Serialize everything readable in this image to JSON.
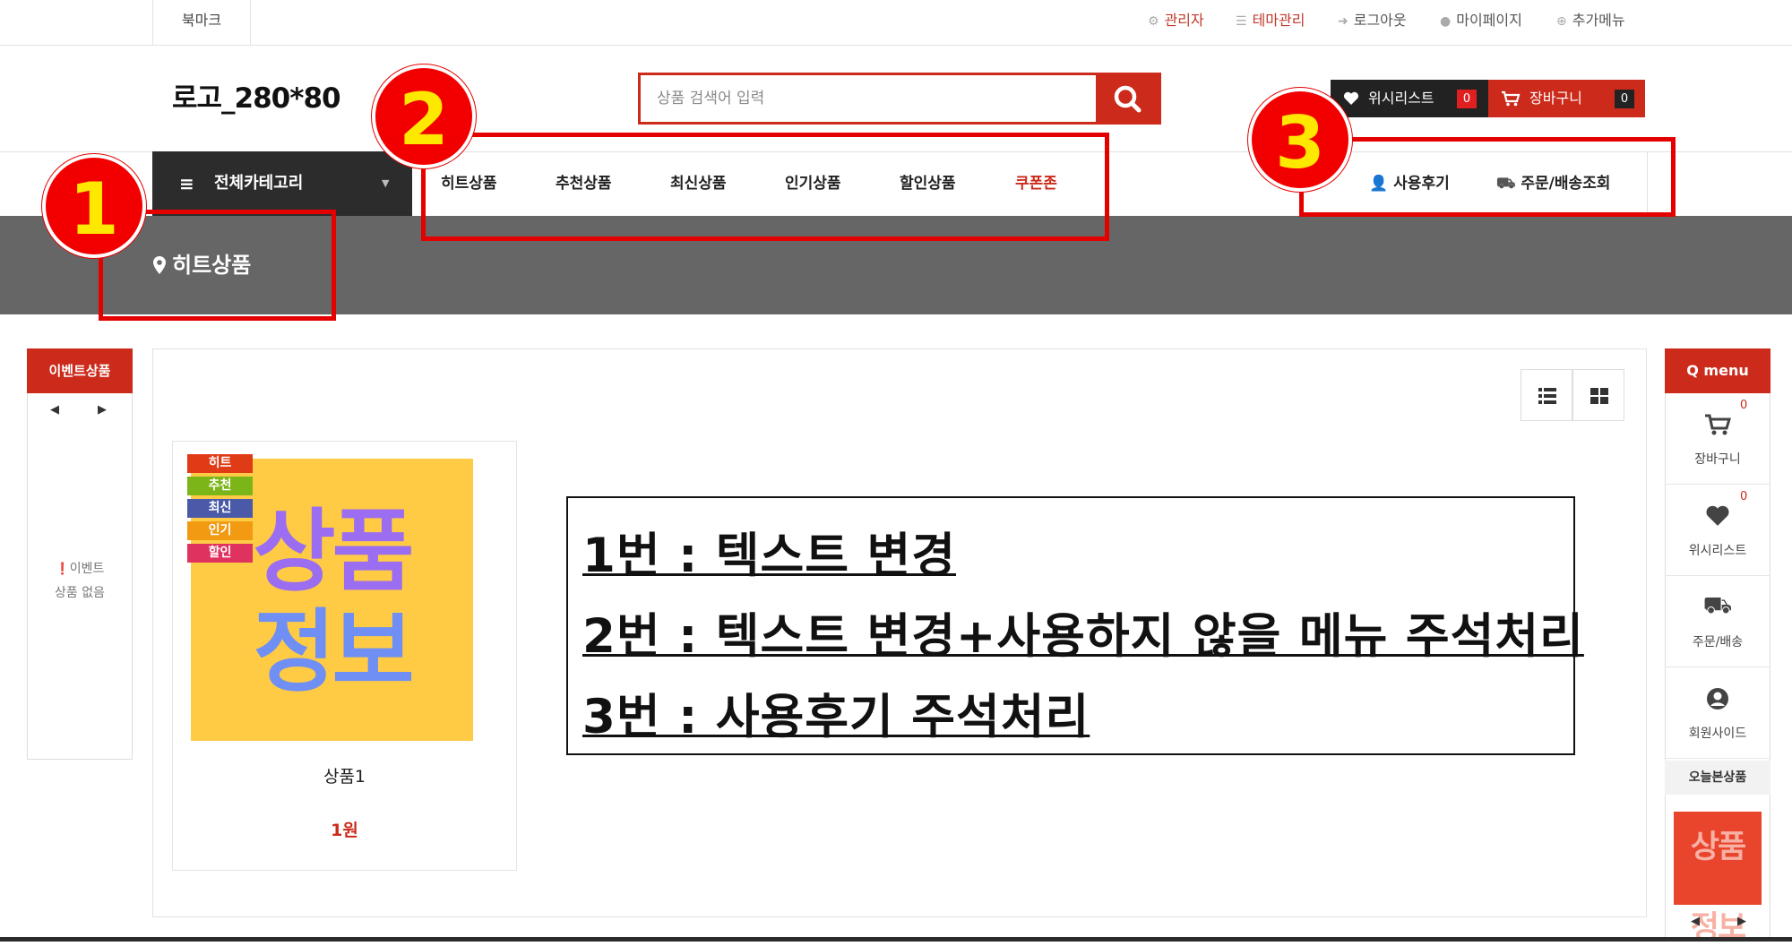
{
  "topbar": {
    "bookmark": "북마크",
    "admin": "관리자",
    "theme": "테마관리",
    "logout": "로그아웃",
    "mypage": "마이페이지",
    "more": "추가메뉴"
  },
  "header": {
    "logo": "로고_280*80",
    "search_placeholder": "상품 검색어 입력",
    "wishlist_label": "위시리스트",
    "wishlist_count": "0",
    "cart_label": "장바구니",
    "cart_count": "0"
  },
  "nav": {
    "all_categories": "전체카테고리",
    "items": [
      "히트상품",
      "추천상품",
      "최신상품",
      "인기상품",
      "할인상품",
      "쿠폰존"
    ],
    "review": "사용후기",
    "order": "주문/배송조회"
  },
  "breadcrumb": "히트상품",
  "event": {
    "title": "이벤트상품",
    "empty_line1": "이벤트",
    "empty_line2": "상품 없음"
  },
  "product": {
    "tags": [
      "히트",
      "추천",
      "최신",
      "인기",
      "할인"
    ],
    "image_text_1": "상품",
    "image_text_2": "정보",
    "name": "상품1",
    "price": "1원"
  },
  "annotation": {
    "markers": [
      "1",
      "2",
      "3"
    ],
    "lines": [
      "1번 : 텍스트 변경",
      "2번 : 텍스트 변경+사용하지 않을 메뉴 주석처리",
      "3번 : 사용후기 주석처리"
    ]
  },
  "quick_menu": {
    "title": "Q menu",
    "cart": "장바구니",
    "cart_count": "0",
    "wishlist": "위시리스트",
    "wishlist_count": "0",
    "order": "주문/배송",
    "member": "회원사이드",
    "today": "오늘본상품",
    "thumb_text_1": "상품",
    "thumb_text_2": "정보"
  },
  "colors": {
    "accent": "#cc2a1b",
    "band": "#666667",
    "tag_hit": "#e03b17",
    "tag_recommend": "#7cb518",
    "tag_new": "#4a5aa8",
    "tag_popular": "#f19a12",
    "tag_sale": "#e0325f"
  }
}
